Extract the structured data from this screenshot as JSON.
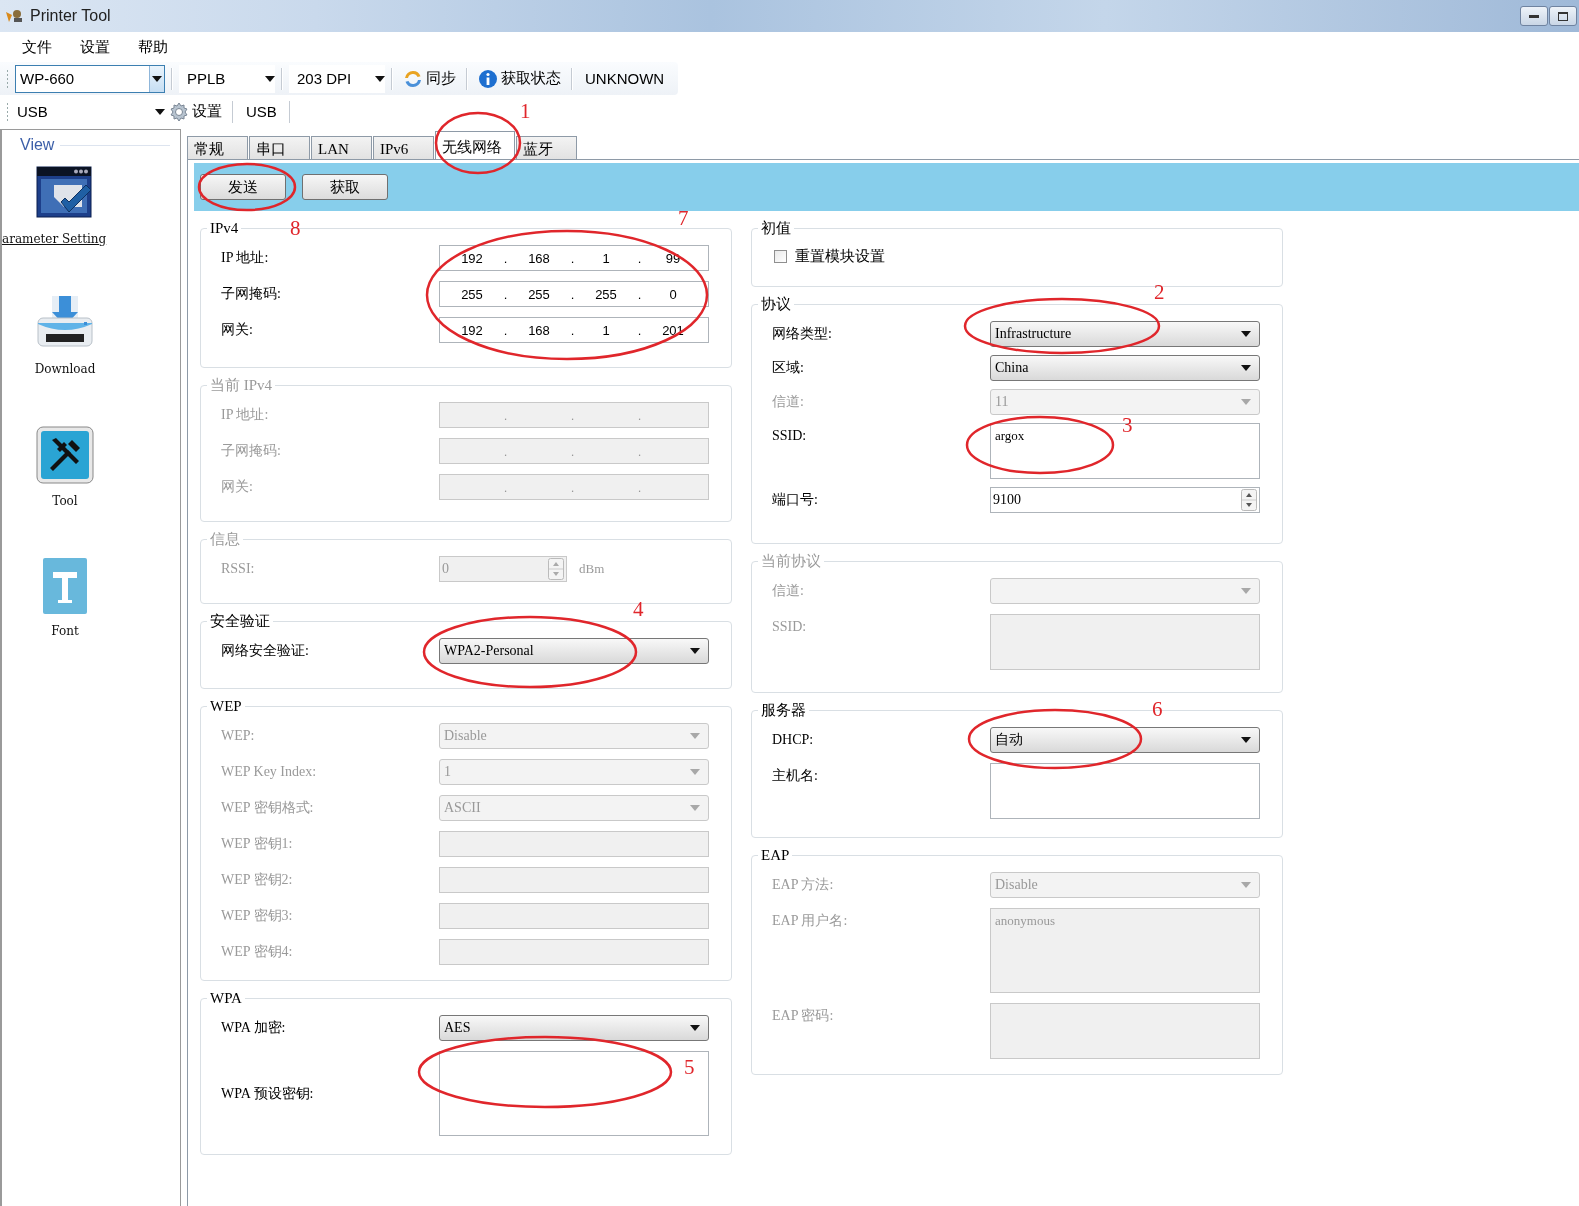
{
  "window": {
    "title": "Printer Tool"
  },
  "menu": [
    "文件",
    "设置",
    "帮助"
  ],
  "toolbar": {
    "printer": {
      "value": "WP-660",
      "focused": true
    },
    "language": "PPLB",
    "resolution": "203 DPI",
    "sync": "同步",
    "get_status": "获取状态",
    "status": "UNKNOWN"
  },
  "toolbar_2": {
    "port": "USB",
    "settings": "设置",
    "port_label": "USB"
  },
  "sidebar": {
    "title": "View",
    "items": [
      {
        "label": "arameter Setting",
        "kind": "parameter",
        "selected": true
      },
      {
        "label": "Download",
        "kind": "download",
        "selected": false
      },
      {
        "label": "Tool",
        "kind": "tool",
        "selected": false
      },
      {
        "label": "Font",
        "kind": "font",
        "selected": false
      }
    ]
  },
  "tabs": [
    {
      "label": "常规",
      "selected": false
    },
    {
      "label": "串口",
      "selected": false
    },
    {
      "label": "LAN",
      "selected": false
    },
    {
      "label": "IPv6",
      "selected": false
    },
    {
      "label": "无线网络",
      "selected": true
    },
    {
      "label": "蓝牙",
      "selected": false
    }
  ],
  "actions": [
    "发送",
    "获取"
  ],
  "columns": [
    {
      "groups": [
        {
          "title": "IPv4",
          "disabled": false,
          "fields": [
            {
              "label": "IP 地址:",
              "kind": "ip",
              "octets": [
                "192",
                "168",
                "1",
                "99"
              ],
              "separator": ".",
              "disabled": false
            },
            {
              "label": "子网掩码:",
              "kind": "ip",
              "octets": [
                "255",
                "255",
                "255",
                "0"
              ],
              "separator": ".",
              "disabled": false
            },
            {
              "label": "网关:",
              "kind": "ip",
              "octets": [
                "192",
                "168",
                "1",
                "201"
              ],
              "separator": ".",
              "disabled": false
            }
          ]
        },
        {
          "title": "当前 IPv4",
          "disabled": true,
          "fields": [
            {
              "label": "IP 地址:",
              "kind": "ip",
              "separator": ".",
              "disabled": true
            },
            {
              "label": "子网掩码:",
              "kind": "ip",
              "separator": ".",
              "disabled": true
            },
            {
              "label": "网关:",
              "kind": "ip",
              "separator": ".",
              "disabled": true
            }
          ]
        },
        {
          "title": "信息",
          "disabled": true,
          "fields": [
            {
              "label": "RSSI:",
              "kind": "spin",
              "value": "0",
              "unit": "dBm",
              "disabled": true
            }
          ]
        },
        {
          "title": "安全验证",
          "disabled": false,
          "fields": [
            {
              "label": "网络安全验证:",
              "kind": "combo",
              "value": "WPA2-Personal",
              "disabled": false
            }
          ]
        },
        {
          "title": "WEP",
          "disabled": false,
          "fields": [
            {
              "label": "WEP:",
              "kind": "combo",
              "value": "Disable",
              "disabled": true
            },
            {
              "label": "WEP Key Index:",
              "kind": "combo",
              "value": "1",
              "disabled": true
            },
            {
              "label": "WEP 密钥格式:",
              "kind": "combo",
              "value": "ASCII",
              "disabled": true
            },
            {
              "label": "WEP 密钥1:",
              "kind": "text",
              "disabled": true
            },
            {
              "label": "WEP 密钥2:",
              "kind": "text",
              "disabled": true
            },
            {
              "label": "WEP 密钥3:",
              "kind": "text",
              "disabled": true
            },
            {
              "label": "WEP 密钥4:",
              "kind": "text",
              "disabled": true
            }
          ]
        },
        {
          "title": "WPA",
          "disabled": false,
          "fields": [
            {
              "label": "WPA 加密:",
              "kind": "combo",
              "value": "AES",
              "disabled": false
            },
            {
              "label": "WPA 预设密钥:",
              "kind": "textarea",
              "disabled": false
            }
          ]
        }
      ]
    },
    {
      "groups": [
        {
          "title": "初值",
          "disabled": false,
          "fields": [
            {
              "label": "重置模块设置",
              "kind": "checkbox",
              "checked": false
            }
          ]
        },
        {
          "title": "协议",
          "disabled": false,
          "fields": [
            {
              "label": "网络类型:",
              "kind": "combo",
              "value": "Infrastructure",
              "disabled": false
            },
            {
              "label": "区域:",
              "kind": "combo",
              "value": "China",
              "disabled": false
            },
            {
              "label": "信道:",
              "kind": "combo",
              "value": "11",
              "disabled": true
            },
            {
              "label": "SSID:",
              "kind": "textarea",
              "value": "argox",
              "disabled": false
            },
            {
              "label": "端口号:",
              "kind": "spin",
              "value": "9100",
              "disabled": false
            }
          ]
        },
        {
          "title": "当前协议",
          "disabled": true,
          "fields": [
            {
              "label": "信道:",
              "kind": "combo",
              "disabled": true
            },
            {
              "label": "SSID:",
              "kind": "textarea",
              "disabled": true
            }
          ]
        },
        {
          "title": "服务器",
          "disabled": false,
          "fields": [
            {
              "label": "DHCP:",
              "kind": "combo",
              "value": "自动",
              "disabled": false
            },
            {
              "label": "主机名:",
              "kind": "textarea",
              "disabled": false
            }
          ]
        },
        {
          "title": "EAP",
          "disabled": false,
          "fields": [
            {
              "label": "EAP 方法:",
              "kind": "combo",
              "value": "Disable",
              "disabled": true
            },
            {
              "label": "EAP 用户名:",
              "kind": "textarea",
              "value": "anonymous",
              "disabled": true
            },
            {
              "label": "EAP 密码:",
              "kind": "textarea",
              "disabled": true
            }
          ]
        }
      ]
    }
  ],
  "annotations": [
    "1",
    "2",
    "3",
    "4",
    "5",
    "6",
    "7",
    "8"
  ]
}
